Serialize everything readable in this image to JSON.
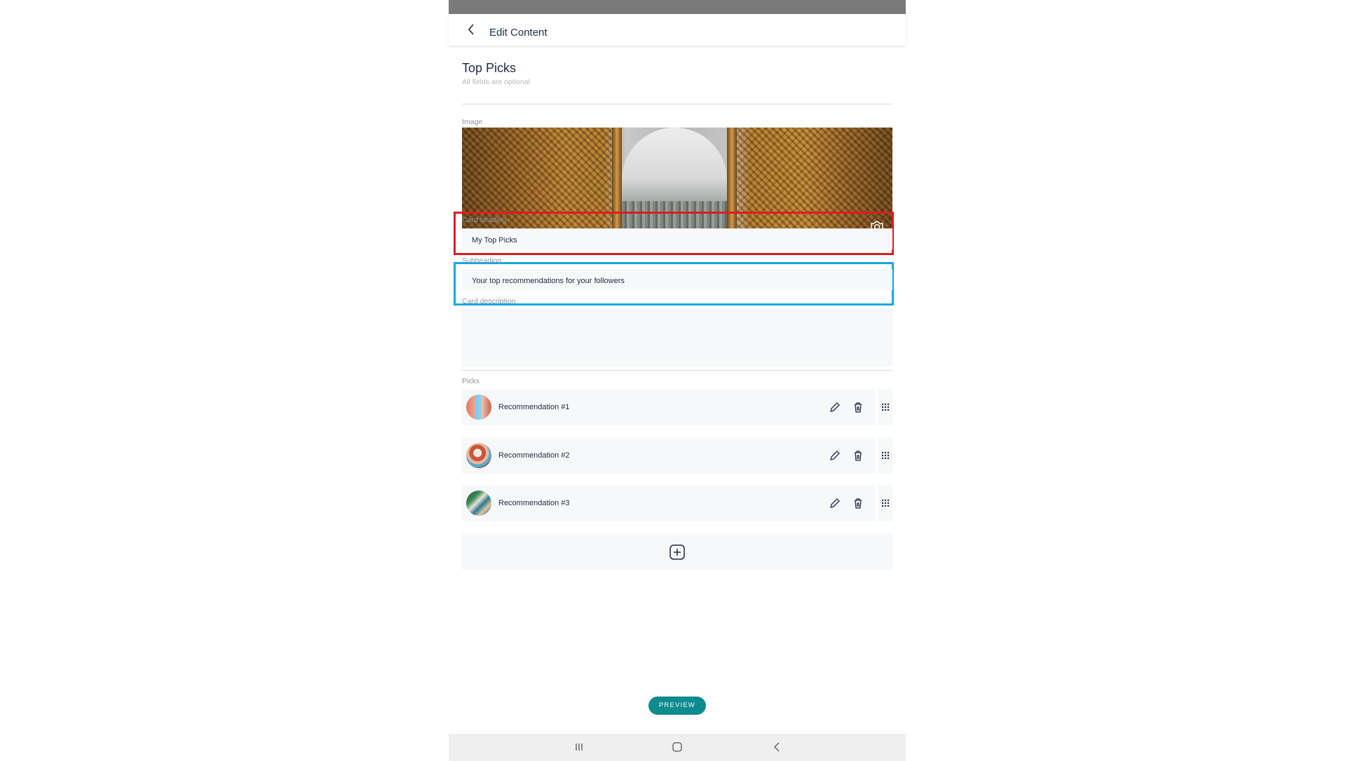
{
  "header": {
    "title": "Edit Content"
  },
  "page": {
    "title": "Top Picks",
    "note": "All fields are optional"
  },
  "image_section": {
    "label": "Image"
  },
  "card_heading": {
    "label": "Card heading",
    "value": "My Top Picks"
  },
  "subheading": {
    "label": "Subheading",
    "value": "Your top recommendations for your followers"
  },
  "card_description": {
    "label": "Card description",
    "value": ""
  },
  "picks": {
    "label": "Picks",
    "items": [
      {
        "label": "Recommendation #1"
      },
      {
        "label": "Recommendation #2"
      },
      {
        "label": "Recommendation #3"
      }
    ]
  },
  "preview_button": {
    "label": "PREVIEW"
  },
  "colors": {
    "accent": "#0e8b8e",
    "heading_highlight": "#e11b22",
    "subheading_highlight": "#12a7e3"
  },
  "icons": [
    "back-arrow-icon",
    "camera-icon",
    "pencil-icon",
    "trash-icon",
    "drag-handle-icon",
    "add-icon",
    "recents-icon",
    "home-icon",
    "nav-back-icon"
  ]
}
